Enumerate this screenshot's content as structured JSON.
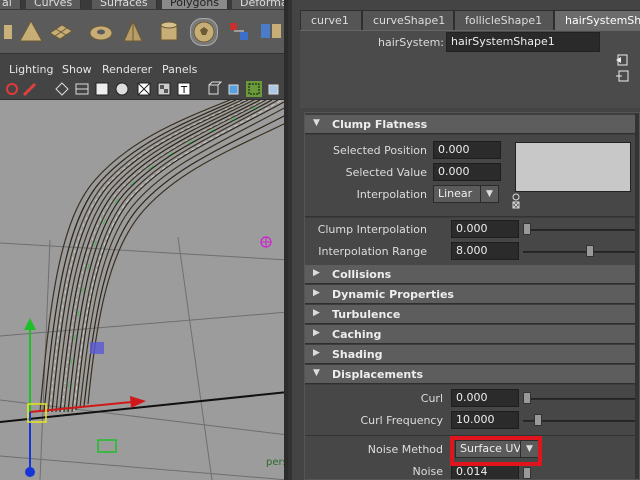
{
  "shelf": {
    "tabs": [
      "al",
      "Curves",
      "Surfaces",
      "Polygons",
      "Deforma"
    ],
    "active_tab": "Polygons"
  },
  "viewport": {
    "menu": [
      "Lighting",
      "Show",
      "Renderer",
      "Panels"
    ],
    "camera_label": "pers"
  },
  "attribute_editor": {
    "node_tabs": [
      "curve1",
      "curveShape1",
      "follicleShape1",
      "hairSystemShape"
    ],
    "active_node_tab": "hairSystemShape",
    "node_label": "hairSystem:",
    "node_value": "hairSystemShape1",
    "sections": {
      "clump_flatness": {
        "title": "Clump Flatness",
        "expanded": true,
        "selected_position_label": "Selected Position",
        "selected_position_value": "0.000",
        "selected_value_label": "Selected Value",
        "selected_value_value": "0.000",
        "interpolation_label": "Interpolation",
        "interpolation_value": "Linear"
      },
      "clump_misc": {
        "clump_interpolation_label": "Clump Interpolation",
        "clump_interpolation_value": "0.000",
        "clump_interpolation_slider": 0.0,
        "interpolation_range_label": "Interpolation Range",
        "interpolation_range_value": "8.000",
        "interpolation_range_slider": 0.58
      },
      "collapsed": [
        "Collisions",
        "Dynamic Properties",
        "Turbulence",
        "Caching",
        "Shading"
      ],
      "displacements": {
        "title": "Displacements",
        "expanded": true,
        "curl_label": "Curl",
        "curl_value": "0.000",
        "curl_slider": 0.0,
        "curl_frequency_label": "Curl Frequency",
        "curl_frequency_value": "10.000",
        "curl_frequency_slider": 0.1,
        "noise_method_label": "Noise Method",
        "noise_method_value": "Surface UV",
        "noise_label": "Noise",
        "noise_value": "0.014"
      }
    }
  },
  "colors": {
    "highlight": "#e0141c",
    "panel_bg": "#444444",
    "viewport_bg": "#9c9c9c"
  }
}
